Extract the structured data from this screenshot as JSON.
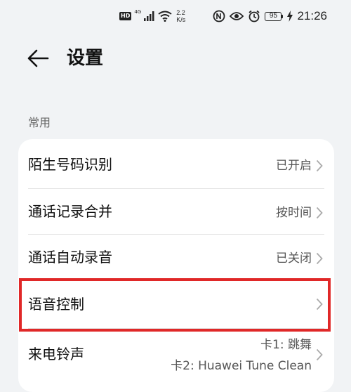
{
  "statusbar": {
    "hd_badge": "HD",
    "network_type": "4G",
    "speed_value": "2.2",
    "speed_unit": "K/s",
    "battery_level": "95",
    "time": "21:26",
    "icons": [
      "hd-icon",
      "signal-icon",
      "wifi-icon",
      "nfc-icon",
      "eye-comfort-icon",
      "alarm-icon",
      "battery-icon",
      "charging-icon"
    ]
  },
  "header": {
    "title": "设置",
    "back_icon": "back-arrow-icon"
  },
  "section": {
    "label": "常用"
  },
  "settings": [
    {
      "label": "陌生号码识别",
      "value": "已开启"
    },
    {
      "label": "通话记录合并",
      "value": "按时间"
    },
    {
      "label": "通话自动录音",
      "value": "已关闭"
    },
    {
      "label": "语音控制",
      "value": ""
    },
    {
      "label": "来电铃声",
      "values": [
        "卡1: 跳舞",
        "卡2: Huawei Tune Clean"
      ]
    }
  ],
  "colors": {
    "background": "#f1f3f5",
    "card": "#ffffff",
    "highlight": "#e02828"
  }
}
